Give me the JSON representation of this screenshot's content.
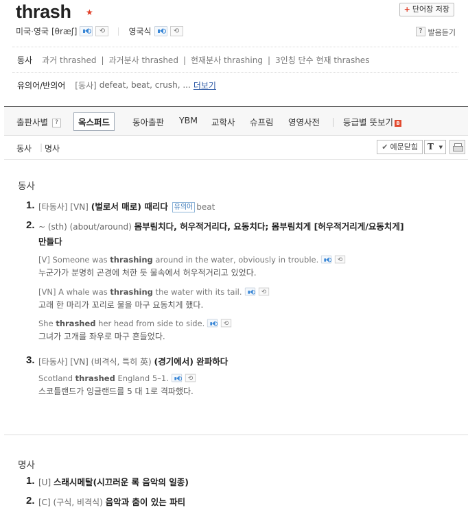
{
  "entry": {
    "word": "thrash",
    "star": "★",
    "save_button": "단어장 저장",
    "pron_us_uk_label": "미국·영국",
    "pron_us_uk_ipa": "[θræʃ]",
    "pron_uk_label": "영국식",
    "pron_help_q": "?",
    "pron_help_label": "발음듣기"
  },
  "info": {
    "pos_label": "동사",
    "forms": [
      "과거 thrashed",
      "과거분사 thrashed",
      "현재분사 thrashing",
      "3인칭 단수 현재 thrashes"
    ],
    "syn_label": "유의어/반의어",
    "syn_tag": "[동사]",
    "syn_list": "defeat, beat, crush, ...",
    "syn_more": "더보기"
  },
  "tabs": {
    "publisher_label": "출판사별",
    "publisher_q": "?",
    "items": [
      "옥스퍼드",
      "동아출판",
      "YBM",
      "교학사",
      "슈프림",
      "영영사전"
    ],
    "level_label": "등급별 뜻보기",
    "level_badge": "B"
  },
  "posbar": {
    "verb": "동사",
    "noun": "명사",
    "example_toggle": "예문닫힘",
    "font_button": "T"
  },
  "verb_section": {
    "title": "동사",
    "senses": [
      {
        "num": "1.",
        "tags": "[타동사] [VN]",
        "def": "(벌로서 매로) 때리다",
        "syn_badge": "유의어",
        "syn_word": "beat"
      },
      {
        "num": "2.",
        "prefix": "~ (sth) (about/around)",
        "def_line1": "몸부림치다, 허우적거리다, 요동치다; 몸부림치게 [허우적거리게/요동치게]",
        "def_line2": "만들다",
        "examples": [
          {
            "pre": "[V] Someone was ",
            "bold": "thrashing",
            "post": " around in the water, obviously in trouble.",
            "ko": "누군가가 분명히 곤경에 처한 듯 물속에서 허우적거리고 있었다."
          },
          {
            "pre": "[VN] A whale was ",
            "bold": "thrashing",
            "post": " the water with its tail.",
            "ko": "고래 한 마리가 꼬리로 물을 마구 요동치게 했다."
          },
          {
            "pre": "She ",
            "bold": "thrashed",
            "post": " her head from side to side.",
            "ko": "그녀가 고개를 좌우로 마구 흔들었다."
          }
        ]
      },
      {
        "num": "3.",
        "tags": "[타동사] [VN] (비격식, 특히 英)",
        "def": "(경기에서) 완파하다",
        "examples": [
          {
            "pre": "Scotland ",
            "bold": "thrashed",
            "post": " England 5–1.",
            "ko": "스코틀랜드가 잉글랜드를 5 대 1로 격파했다."
          }
        ]
      }
    ]
  },
  "noun_section": {
    "title": "명사",
    "senses": [
      {
        "num": "1.",
        "tags": "[U]",
        "def": "스래시메탈(시끄러운 록 음악의 일종)"
      },
      {
        "num": "2.",
        "tags": "[C] (구식, 비격식)",
        "def": "음악과 춤이 있는 파티"
      }
    ]
  }
}
